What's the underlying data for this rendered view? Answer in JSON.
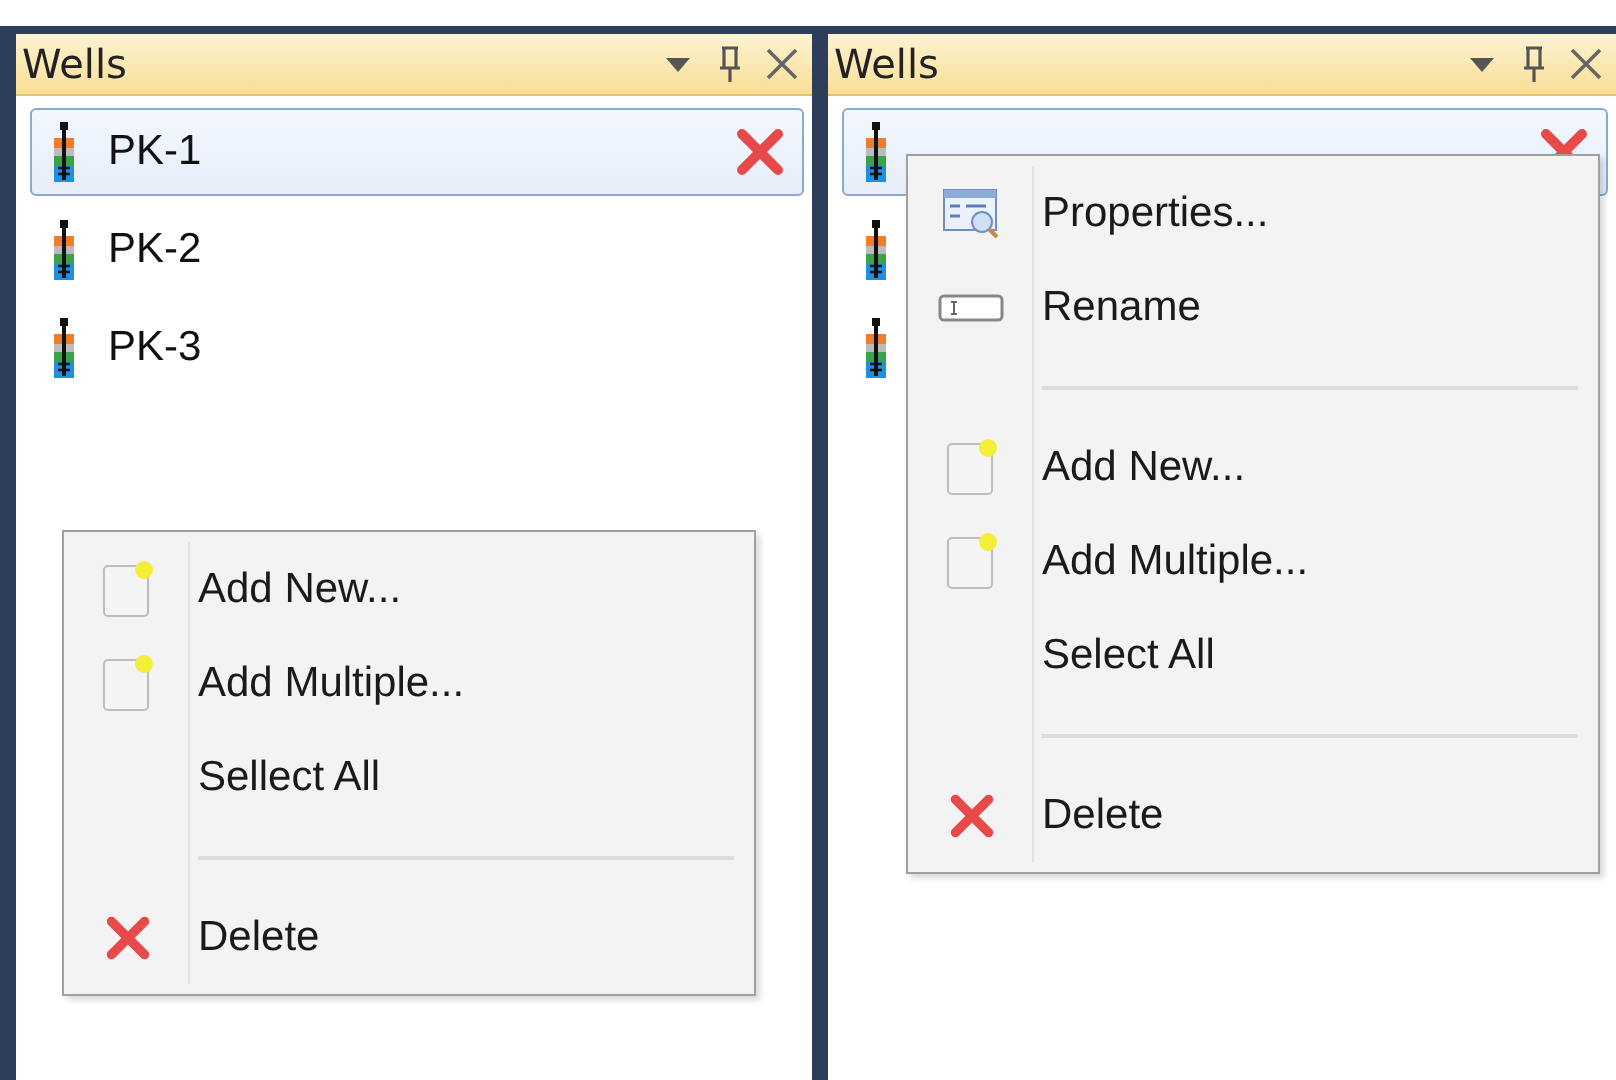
{
  "panels": [
    {
      "title": "Wells",
      "wells": [
        {
          "name": "PK-1",
          "selected": true
        },
        {
          "name": "PK-2",
          "selected": false
        },
        {
          "name": "PK-3",
          "selected": false
        }
      ],
      "menu": {
        "items": [
          {
            "kind": "new",
            "label": "Add New..."
          },
          {
            "kind": "new",
            "label": "Add Multiple..."
          },
          {
            "kind": "plain",
            "label": "Sellect All"
          },
          {
            "kind": "separator"
          },
          {
            "kind": "delete",
            "label": "Delete"
          }
        ]
      }
    },
    {
      "title": "Wells",
      "wells": [
        {
          "selected": true
        },
        {
          "selected": false
        },
        {
          "selected": false
        }
      ],
      "menu": {
        "items": [
          {
            "kind": "properties",
            "label": "Properties..."
          },
          {
            "kind": "rename",
            "label": "Rename"
          },
          {
            "kind": "separator"
          },
          {
            "kind": "new",
            "label": "Add New..."
          },
          {
            "kind": "new",
            "label": "Add Multiple..."
          },
          {
            "kind": "plain",
            "label": "Select All"
          },
          {
            "kind": "separator"
          },
          {
            "kind": "delete",
            "label": "Delete"
          }
        ]
      }
    }
  ]
}
